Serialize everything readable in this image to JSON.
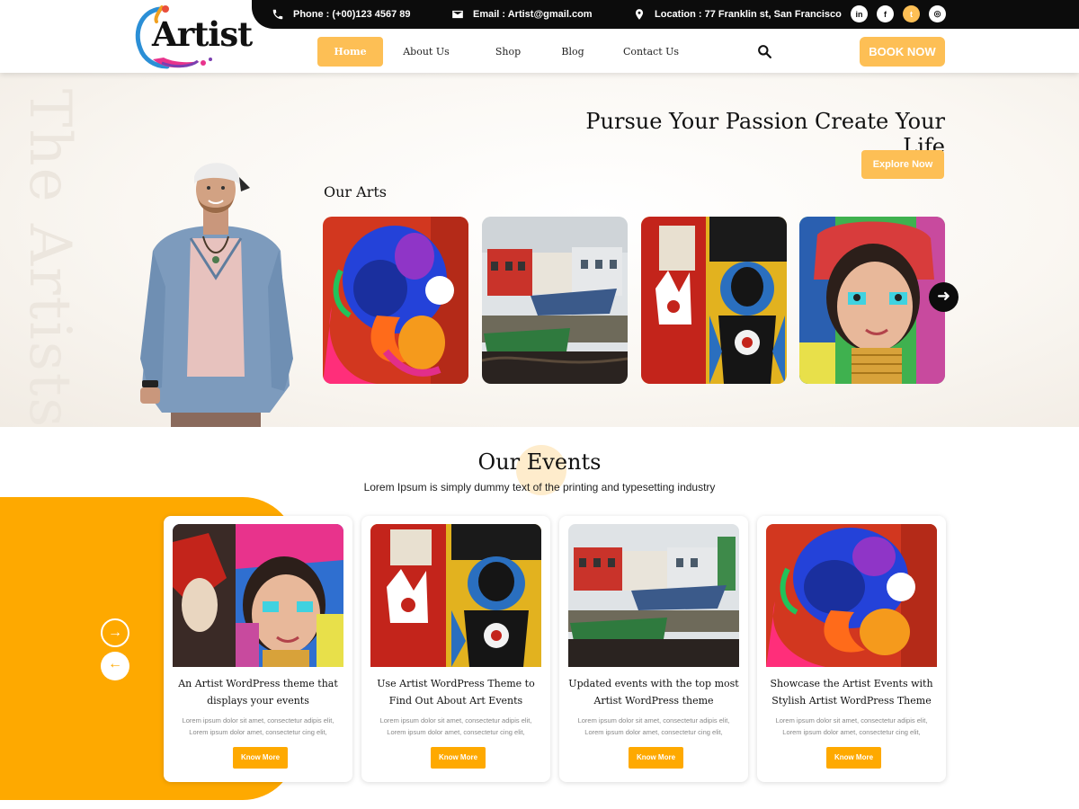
{
  "topbar": {
    "phone": "Phone : (+00)123 4567 89",
    "email": "Email : Artist@gmail.com",
    "location": "Location : 77 Franklin st, San Francisco",
    "socials": [
      {
        "icon": "linkedin-icon",
        "glyph": "in"
      },
      {
        "icon": "facebook-icon",
        "glyph": "f"
      },
      {
        "icon": "twitter-icon",
        "glyph": "t"
      },
      {
        "icon": "instagram-icon",
        "glyph": "◎"
      }
    ]
  },
  "logo": {
    "text": "Artist"
  },
  "nav": {
    "items": [
      "Home",
      "About Us",
      "Shop",
      "Blog",
      "Contact Us"
    ],
    "active": "Home",
    "book_label": "BOOK NOW"
  },
  "hero": {
    "watermark": "The Artists",
    "title": "Pursue Your Passion Create Your Life",
    "explore_label": "Explore Now",
    "arts_heading": "Our Arts"
  },
  "events": {
    "title": "Our Events",
    "subtitle": "Lorem Ipsum is simply dummy text of the printing and typesetting industry",
    "cards": [
      {
        "title": "An Artist WordPress theme that displays your events",
        "text": "Lorem ipsum dolor sit amet, consectetur adipis elit, Lorem ipsum dolor amet, consectetur cing elit,",
        "button": "Know More"
      },
      {
        "title": "Use Artist WordPress Theme to Find Out About Art Events",
        "text": "Lorem ipsum dolor sit amet, consectetur adipis elit, Lorem ipsum dolor amet, consectetur cing elit,",
        "button": "Know More"
      },
      {
        "title": "Updated events with the top most Artist WordPress theme",
        "text": "Lorem ipsum dolor sit amet, consectetur adipis elit, Lorem ipsum dolor amet, consectetur cing elit,",
        "button": "Know More"
      },
      {
        "title": "Showcase the Artist Events with Stylish Artist WordPress Theme",
        "text": "Lorem ipsum dolor sit amet, consectetur adipis elit, Lorem ipsum dolor amet, consectetur cing elit,",
        "button": "Know More"
      }
    ]
  },
  "colors": {
    "accent": "#fdbf55",
    "orange": "#fea900",
    "dark": "#0c0c0c"
  }
}
